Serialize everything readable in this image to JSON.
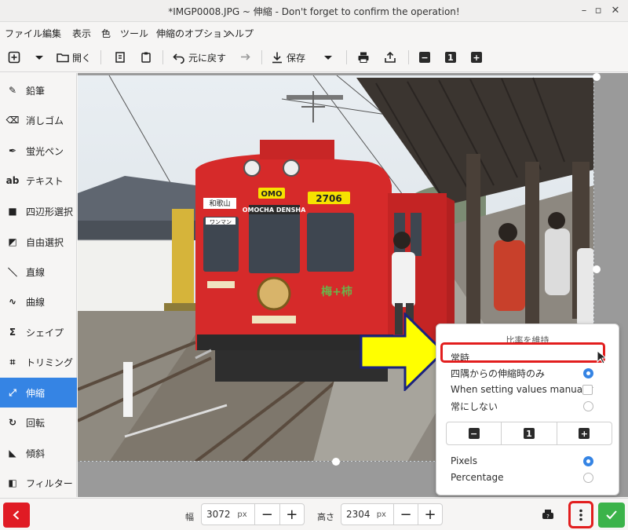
{
  "window": {
    "title": "*IMGP0008.JPG ~ 伸縮 - Don't forget to confirm the operation!"
  },
  "menubar": {
    "items": [
      "ファイル",
      "編集",
      "表示",
      "色",
      "ツール",
      "伸縮のオプション",
      "ヘルプ"
    ]
  },
  "toolbar": {
    "open_label": "開く",
    "undo_label": "元に戻す",
    "save_label": "保存",
    "zoom_value": "1"
  },
  "sidebar": {
    "tools": [
      {
        "label": "鉛筆",
        "icon": "pencil-icon",
        "glyph": "✎"
      },
      {
        "label": "消しゴム",
        "icon": "eraser-icon",
        "glyph": "⌫"
      },
      {
        "label": "蛍光ペン",
        "icon": "highlighter-icon",
        "glyph": "✒"
      },
      {
        "label": "テキスト",
        "icon": "text-icon",
        "glyph": "ab"
      },
      {
        "label": "四辺形選択",
        "icon": "rect-select-icon",
        "glyph": "■"
      },
      {
        "label": "自由選択",
        "icon": "free-select-icon",
        "glyph": "◩"
      },
      {
        "label": "直線",
        "icon": "line-icon",
        "glyph": "＼"
      },
      {
        "label": "曲線",
        "icon": "curve-icon",
        "glyph": "∿"
      },
      {
        "label": "シェイプ",
        "icon": "shape-icon",
        "glyph": "Σ"
      },
      {
        "label": "トリミング",
        "icon": "crop-icon",
        "glyph": "⌗"
      },
      {
        "label": "伸縮",
        "icon": "scale-icon",
        "glyph": "⤢"
      },
      {
        "label": "回転",
        "icon": "rotate-icon",
        "glyph": "↻"
      },
      {
        "label": "傾斜",
        "icon": "skew-icon",
        "glyph": "◣"
      },
      {
        "label": "フィルター",
        "icon": "filter-icon",
        "glyph": "◧"
      }
    ],
    "active_index": 10
  },
  "photo_text": {
    "destination": "和歌山",
    "omo": "OMO",
    "number": "2706",
    "oneman": "ワンマン",
    "densha": "OMOCHA DENSHA",
    "side_text": "梅+柿"
  },
  "popover": {
    "header": "比率を維持",
    "options": [
      {
        "label": "常時",
        "type": "radio",
        "checked": false
      },
      {
        "label": "四隅からの伸縮時のみ",
        "type": "radio",
        "checked": true
      },
      {
        "label": "When setting values manually",
        "type": "check",
        "checked": false
      },
      {
        "label": "常にしない",
        "type": "radio",
        "checked": false
      }
    ],
    "zoom_value": "1",
    "units": [
      {
        "label": "Pixels",
        "checked": true
      },
      {
        "label": "Percentage",
        "checked": false
      }
    ]
  },
  "bottombar": {
    "width_label": "幅",
    "width_value": "3072",
    "width_unit": "px",
    "height_label": "高さ",
    "height_value": "2304",
    "height_unit": "px"
  },
  "colors": {
    "accent": "#3584e4",
    "highlight": "#e21e1e",
    "arrow": "#ffff00",
    "cancel": "#e01b24",
    "apply": "#3bb34a"
  }
}
